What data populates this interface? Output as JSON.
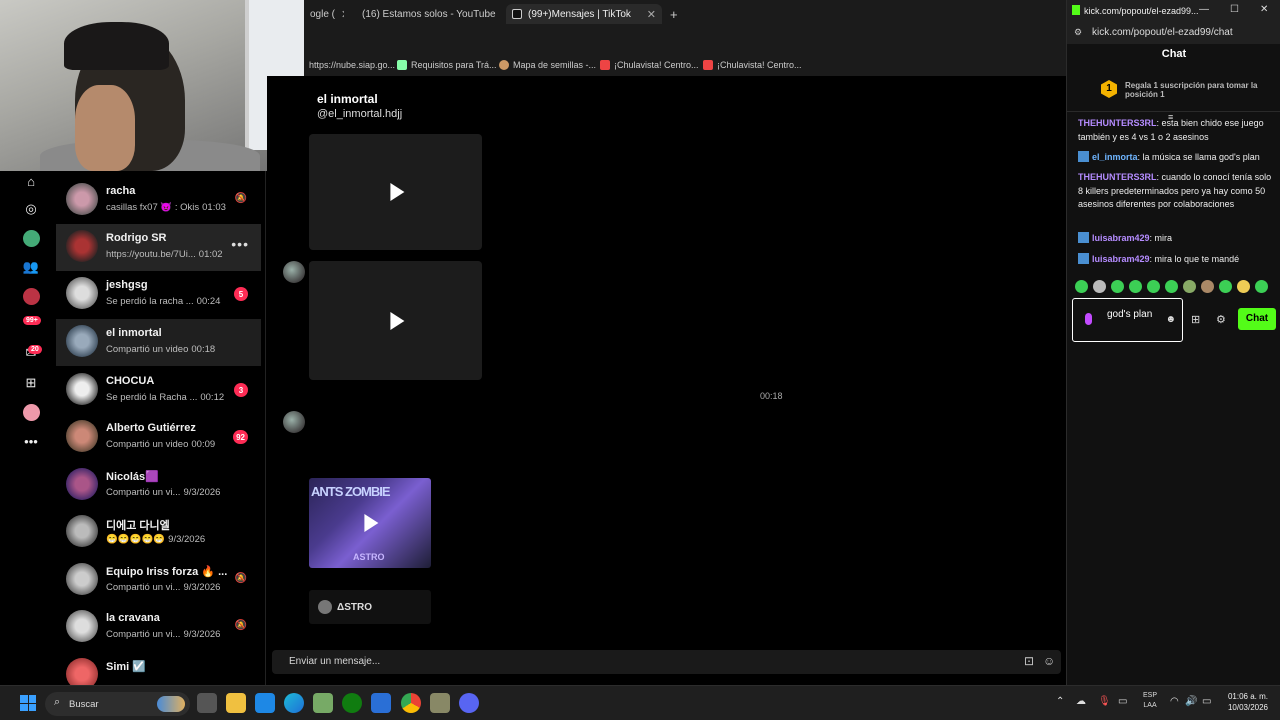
{
  "browser": {
    "tabs": [
      {
        "title": "ogle (",
        "active": false
      },
      {
        "title": "(16) Estamos solos - YouTube",
        "active": false
      },
      {
        "title": "(99+)Mensajes | TikTok",
        "active": true
      }
    ],
    "new_tab": "+",
    "bookmarks": [
      "https://nube.siap.go...",
      "Requisitos para Trá...",
      "Mapa de semillas -...",
      "¡Chulavista! Centro...",
      "¡Chulavista! Centro..."
    ]
  },
  "rail": {
    "badges": {
      "notifications": "99+",
      "messages": "20"
    }
  },
  "conversations": [
    {
      "name": "racha",
      "preview": "casillas fx07 😈 : Okis",
      "time": "01:03",
      "badge": "",
      "muted": true,
      "state": "normal"
    },
    {
      "name": "Rodrigo SR",
      "preview": "https://youtu.be/7Ui...",
      "time": "01:02",
      "badge": "",
      "muted": false,
      "state": "hover"
    },
    {
      "name": "jeshgsg",
      "preview": "Se perdió la racha ...",
      "time": "00:24",
      "badge": "5",
      "muted": false,
      "state": "normal"
    },
    {
      "name": "el inmortal",
      "preview": "Compartió un video",
      "time": "00:18",
      "badge": "",
      "muted": false,
      "state": "selected"
    },
    {
      "name": "CHOCUA",
      "preview": "Se perdió la Racha ...",
      "time": "00:12",
      "badge": "3",
      "muted": false,
      "state": "normal"
    },
    {
      "name": "Alberto Gutiérrez",
      "preview": "Compartió un video",
      "time": "00:09",
      "badge": "92",
      "muted": false,
      "state": "normal"
    },
    {
      "name": "Nicolás🟪",
      "preview": "Compartió un vi...",
      "time": "9/3/2026",
      "badge": "",
      "muted": false,
      "state": "normal"
    },
    {
      "name": "디에고 다니엘",
      "preview": "😁😁😁😁😁",
      "time": "9/3/2026",
      "badge": "",
      "muted": false,
      "state": "normal"
    },
    {
      "name": "Equipo Iriss forza 🔥 ...",
      "preview": "Compartió un vi...",
      "time": "9/3/2026",
      "badge": "",
      "muted": true,
      "state": "normal"
    },
    {
      "name": "la cravana",
      "preview": "Compartió un vi...",
      "time": "9/3/2026",
      "badge": "",
      "muted": true,
      "state": "normal"
    },
    {
      "name": "Simi ☑️",
      "preview": "",
      "time": "",
      "badge": "",
      "muted": false,
      "state": "normal"
    }
  ],
  "chat": {
    "name": "el inmortal",
    "handle": "@el_inmortal.hdjj",
    "timestamp": "00:18",
    "shared_video_title": "ANTS ZOMBIE",
    "shared_video_sub": "ASTRO",
    "shared_author": "ΔSTRO",
    "input_placeholder": "Enviar un mensaje..."
  },
  "kick": {
    "window_title": "kick.com/popout/el-ezad99...",
    "url": "kick.com/popout/el-ezad99/chat",
    "header": "Chat",
    "promo_rank": "1",
    "promo_text": "Regala 1 suscripción para tomar la posición 1",
    "messages": [
      {
        "user": "THEHUNTERS3RL",
        "text": ": esta bien chido ese juego también y es 4 vs 1 o 2 asesinos",
        "badge": false
      },
      {
        "user": "el_inmorta",
        "text": ": la música se llama god's plan",
        "badge": true
      },
      {
        "user": "THEHUNTERS3RL",
        "text": ": cuando lo conocí tenía solo 8 killers predeterminados pero ya hay como 50 asesinos diferentes por colaboraciones",
        "badge": false
      },
      {
        "user": "luisabram429",
        "text": ": mira",
        "badge": true
      },
      {
        "user": "luisabram429",
        "text": ": mira lo que te mandé",
        "badge": true
      }
    ],
    "input_value": "god's plan",
    "send_label": "Chat",
    "accent": "#53fc18"
  },
  "taskbar": {
    "search_label": "Buscar",
    "lang_top": "ESP",
    "lang_bottom": "LAA",
    "time": "01:06 a. m.",
    "date": "10/03/2026"
  }
}
